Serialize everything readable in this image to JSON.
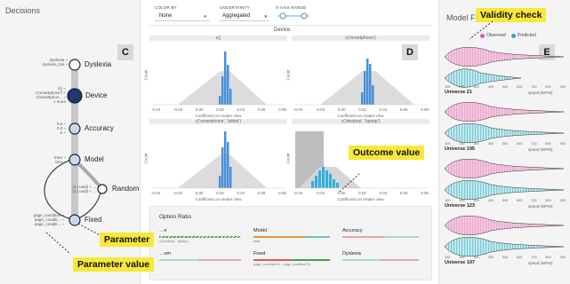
{
  "decisions": {
    "title": "Decisions",
    "callout": "C",
    "nodes": [
      {
        "label": "Dyslexia",
        "opts": [
          "dyslexia ~",
          "dyslexia_bin ~"
        ]
      },
      {
        "label": "Device",
        "opts": [
          "c() ~",
          "c('smartphone') ~",
          "c('smartphon... ~",
          "1 more"
        ]
      },
      {
        "label": "Accuracy",
        "opts": [
          "0.6 ~",
          "0.3 ~",
          "0 ~"
        ]
      },
      {
        "label": "Model",
        "opts": [
          "lmer ~",
          "brm ~"
        ]
      },
      {
        "label": "Random",
        "opts": [
          "(1 | uuid) + ...",
          "(1 | uuid) + ..."
        ]
      },
      {
        "label": "Fixed",
        "opts": [
          "page_condition ~",
          "page_conditi... ~",
          "page_conditi... ~"
        ]
      }
    ]
  },
  "controls": {
    "color_by": {
      "label": "COLOR BY",
      "value": "None"
    },
    "uncertainty": {
      "label": "UNCERTAINTY",
      "value": "Aggregated"
    },
    "x_axis_range": {
      "label": "X-AXIS RANGE"
    }
  },
  "device_panel": {
    "title": "Device",
    "callout": "D",
    "y_label": "Count",
    "x_label": "Coefficient on reader view",
    "ticks": [
      "-0.04",
      "-0.02",
      "0.00",
      "0.02",
      "0.04",
      "0.06",
      "0.08"
    ],
    "plots": [
      {
        "title": "c()"
      },
      {
        "title": "c('smartphone')"
      },
      {
        "title": "c('smartphone', 'tablet')"
      },
      {
        "title": "c('desktop', 'laptop')"
      }
    ]
  },
  "option_ratio": {
    "title": "Option Ratio",
    "items": [
      {
        "label": "…e",
        "sub": "c('desktop', 'laptop')",
        "color": "#49a04a",
        "hatched": true
      },
      {
        "label": "Model",
        "sub": "lmer",
        "color": "#e8933a"
      },
      {
        "label": "Accuracy",
        "sub": "",
        "color": "#e4a5a5"
      },
      {
        "label": "…om",
        "sub": "",
        "color": "#e4a5a5"
      },
      {
        "label": "Fixed",
        "sub": "page_condition*d... page_condition*d...",
        "color": "#d85a5a"
      },
      {
        "label": "Dyslexia",
        "sub": "",
        "color": "#e4a5a5"
      }
    ]
  },
  "model_fit": {
    "title": "Model Fit",
    "callout": "E",
    "legend": {
      "observed": "Observed",
      "predicted": "Predicted",
      "observed_color": "#e58fc2",
      "predicted_color": "#47b8c9"
    },
    "universes": [
      {
        "name": "Universe 21",
        "unit": "speed (WPM)"
      },
      {
        "name": "Universe 195",
        "unit": "speed (WPM)"
      },
      {
        "name": "Universe 123",
        "unit": "speed (WPM)"
      },
      {
        "name": "Universe 197",
        "unit": "speed (WPM)"
      }
    ],
    "axis_ticks": [
      "100",
      "200",
      "300",
      "400",
      "500",
      "600",
      "700",
      "800",
      "900"
    ]
  },
  "annotations": {
    "validity_check": "Validity check",
    "outcome_value": "Outcome value",
    "parameter": "Parameter",
    "parameter_value": "Parameter value"
  }
}
